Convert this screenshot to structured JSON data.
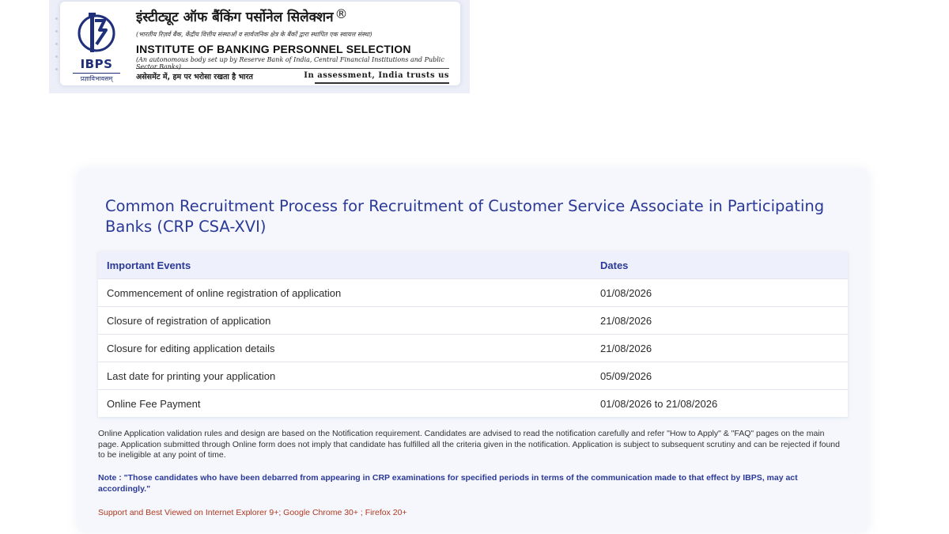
{
  "header": {
    "logo_abbr": "IBPS",
    "logo_motto": "प्रज्ञाविभावसम्",
    "hindi_title": "इंस्टीट्यूट ऑफ बैंकिंग पर्सोनेल सिलेक्शन",
    "registered_mark": "®",
    "hindi_subtitle": "(भारतीय रिज़र्व बैंक, केंद्रीय वित्तीय संस्थाओं व सार्वजनिक क्षेत्र के बैंकों द्वारा स्थापित एक स्वायत्त संस्था)",
    "english_title": "INSTITUTE OF BANKING PERSONNEL SELECTION",
    "english_subtitle": "(An autonomous body set up by Reserve Bank of India, Central Financial Institutions and Public Sector Banks)",
    "tagline_hindi": "असेसमेंट में, हम पर भरोसा रखता है भारत",
    "tagline_english": "In assessment, India trusts us",
    "brand_color": "#1f2f7a"
  },
  "main": {
    "title": "Common Recruitment Process for Recruitment of Customer Service Associate in Participating Banks (CRP CSA-XVI)",
    "table": {
      "headers": [
        "Important Events",
        "Dates"
      ],
      "rows": [
        {
          "event": "Commencement of online registration of application",
          "date": "01/08/2026"
        },
        {
          "event": "Closure of registration of application",
          "date": "21/08/2026"
        },
        {
          "event": "Closure for editing application details",
          "date": "21/08/2026"
        },
        {
          "event": "Last date for printing your application",
          "date": "05/09/2026"
        },
        {
          "event": "Online Fee Payment",
          "date": "01/08/2026 to 21/08/2026"
        }
      ]
    },
    "notice": "Online Application validation rules and design are based on the Notification requirement. Candidates are advised to read the notification carefully and refer \"How to Apply\" & \"FAQ\" pages on the main page. Application submitted through Online form does not imply that candidate has fulfilled all the criteria given in the notification. Application is subject to subsequent scrutiny and can be rejected if found to be ineligible at any point of time.",
    "note": "Note : \"Those candidates who have been debarred from appearing in CRP examinations for specified periods in terms of the communication made to that effect by IBPS, may act accordingly.\"",
    "support": "Support and Best Viewed on Internet Explorer 9+; Google Chrome 30+ ; Firefox 20+"
  },
  "colors": {
    "title": "#2c3a97",
    "header_row_bg": "#eef1fb",
    "card_bg": "#f5f7fc",
    "support_text": "#b0391f"
  }
}
